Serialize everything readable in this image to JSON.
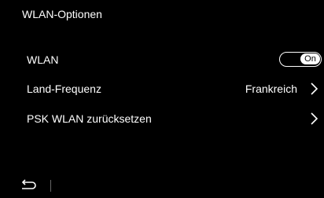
{
  "header": {
    "title": "WLAN-Optionen"
  },
  "settings": {
    "wlan": {
      "label": "WLAN",
      "toggle_state": "On"
    },
    "country_frequency": {
      "label": "Land-Frequenz",
      "value": "Frankreich",
      "icon": "chevron-right-icon"
    },
    "reset_psk": {
      "label": "PSK WLAN zurücksetzen",
      "icon": "chevron-right-icon"
    }
  },
  "footer": {
    "back_icon": "back-arrow-icon"
  },
  "colors": {
    "background": "#000000",
    "text": "#ffffff",
    "divider": "#666666"
  }
}
